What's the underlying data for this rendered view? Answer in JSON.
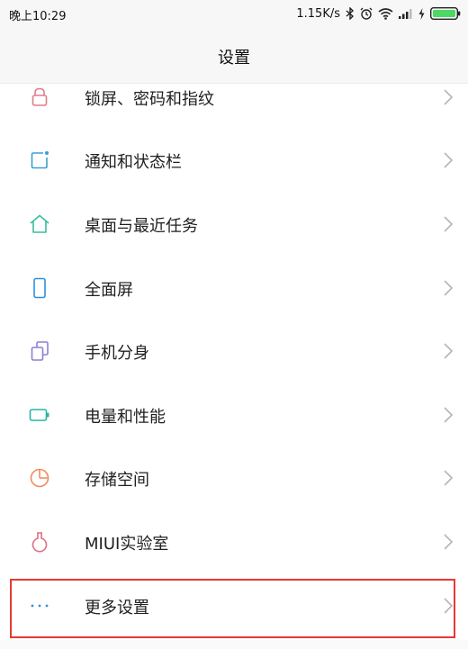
{
  "status_bar": {
    "time": "晚上10:29",
    "network_speed": "1.15K/s"
  },
  "header": {
    "title": "设置"
  },
  "menu": {
    "items": [
      {
        "label": "锁屏、密码和指纹",
        "icon": "lock-icon",
        "color": "#e27b8d"
      },
      {
        "label": "通知和状态栏",
        "icon": "notification-icon",
        "color": "#3a9fd6"
      },
      {
        "label": "桌面与最近任务",
        "icon": "home-icon",
        "color": "#3bbd9e"
      },
      {
        "label": "全面屏",
        "icon": "phone-icon",
        "color": "#2f8fe0"
      },
      {
        "label": "手机分身",
        "icon": "dual-apps-icon",
        "color": "#8d7fd6"
      },
      {
        "label": "电量和性能",
        "icon": "battery-icon",
        "color": "#27b5a5"
      },
      {
        "label": "存储空间",
        "icon": "storage-icon",
        "color": "#f08a5d"
      },
      {
        "label": "MIUI实验室",
        "icon": "lab-flask-icon",
        "color": "#e06f86"
      },
      {
        "label": "更多设置",
        "icon": "more-dots-icon",
        "color": "#3a8fd6"
      }
    ]
  },
  "annotation": {
    "highlight_color": "#e53935",
    "highlighted_item": "更多设置"
  }
}
